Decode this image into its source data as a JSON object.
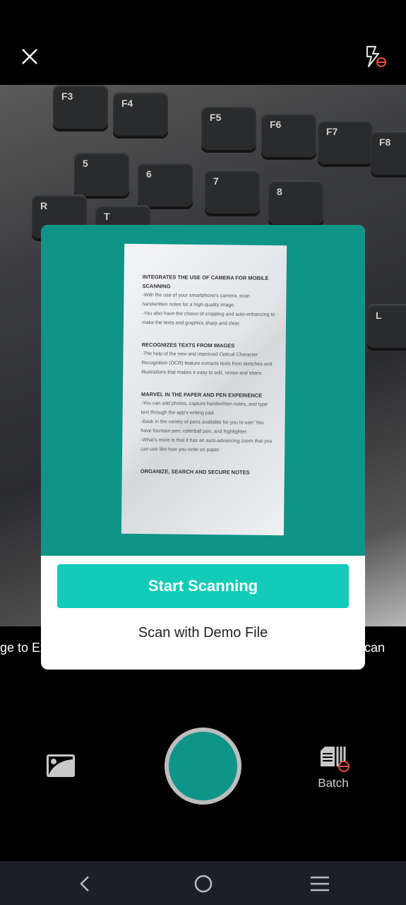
{
  "topbar": {
    "close_icon": "close-icon",
    "flash_icon": "flash-off-icon"
  },
  "camera": {
    "keys": [
      "F3",
      "F4",
      "F5",
      "F6",
      "F7",
      "F8",
      "5",
      "6",
      "7",
      "8",
      "R",
      "T",
      "L"
    ]
  },
  "hints": {
    "left": "ge to Ex",
    "right": "can"
  },
  "dialog": {
    "document": [
      {
        "heading": "INTEGRATES THE USE OF CAMERA FOR MOBILE SCANNING",
        "lines": [
          "-With the use of your smartphone's camera, scan handwritten notes for a high-quality image.",
          "-You also have the choice of cropping and auto-enhancing to make the texts and graphics sharp and clear."
        ]
      },
      {
        "heading": "RECOGNIZES TEXTS FROM IMAGES",
        "lines": [
          "-The help of the new and improved Optical Character Recognition (OCR) feature extracts texts from sketches and illustrations that makes it easy to edit, revise and share."
        ]
      },
      {
        "heading": "MARVEL IN THE PAPER AND PEN EXPERIENCE",
        "lines": [
          "-You can add photos, capture handwritten notes, and type text through the app's writing pad.",
          "-Bask in the variety of pens available for you to use! You have fountain pen, rollerball pen, and highlighter.",
          "-What's more is that it has an auto-advancing zoom that you can use like how you write on paper."
        ]
      },
      {
        "heading": "ORGANIZE, SEARCH AND SECURE NOTES",
        "lines": []
      }
    ],
    "start_label": "Start Scanning",
    "demo_label": "Scan with Demo File"
  },
  "controls": {
    "batch_label": "Batch"
  },
  "colors": {
    "accent": "#12cbb9",
    "teal": "#0f9488",
    "warning": "#e0533d"
  }
}
